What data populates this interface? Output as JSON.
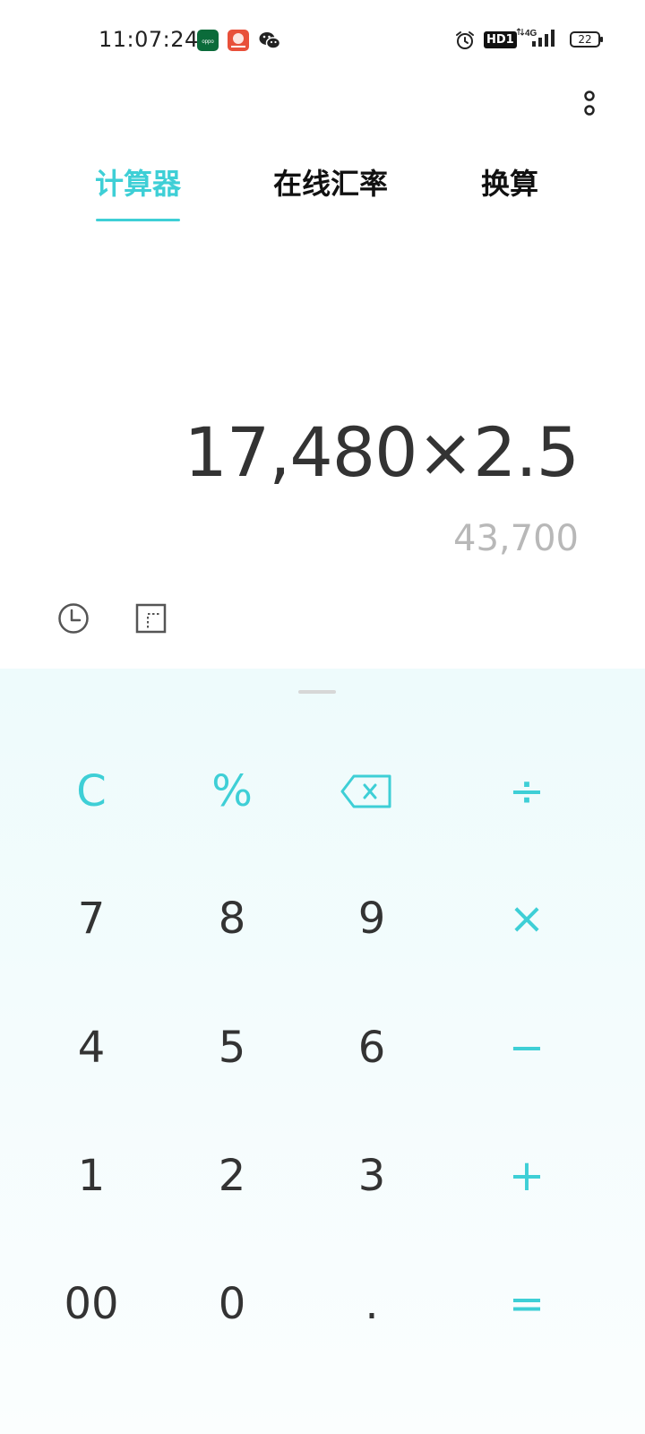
{
  "status_bar": {
    "time": "11:07:24",
    "battery": "22",
    "network": "4G",
    "hd_label": "HD1",
    "app_icons": [
      "oppo-app-icon",
      "red-app-icon",
      "wechat-icon"
    ],
    "indicators": [
      "alarm-icon",
      "hd-icon",
      "signal-icon",
      "battery-icon"
    ]
  },
  "tabs": [
    {
      "label": "计算器",
      "active": true
    },
    {
      "label": "在线汇率",
      "active": false
    },
    {
      "label": "换算",
      "active": false
    }
  ],
  "display": {
    "expression": "17,480×2.5",
    "result": "43,700"
  },
  "tools": [
    "history-icon",
    "scientific-mode-icon"
  ],
  "keypad": {
    "rows": [
      [
        {
          "label": "C",
          "type": "function"
        },
        {
          "label": "%",
          "type": "function"
        },
        {
          "label": "",
          "icon": "backspace-icon",
          "type": "function"
        },
        {
          "label": "÷",
          "type": "operator"
        }
      ],
      [
        {
          "label": "7",
          "type": "digit"
        },
        {
          "label": "8",
          "type": "digit"
        },
        {
          "label": "9",
          "type": "digit"
        },
        {
          "label": "×",
          "type": "operator"
        }
      ],
      [
        {
          "label": "4",
          "type": "digit"
        },
        {
          "label": "5",
          "type": "digit"
        },
        {
          "label": "6",
          "type": "digit"
        },
        {
          "label": "−",
          "type": "operator"
        }
      ],
      [
        {
          "label": "1",
          "type": "digit"
        },
        {
          "label": "2",
          "type": "digit"
        },
        {
          "label": "3",
          "type": "digit"
        },
        {
          "label": "+",
          "type": "operator"
        }
      ],
      [
        {
          "label": "00",
          "type": "digit"
        },
        {
          "label": "0",
          "type": "digit"
        },
        {
          "label": ".",
          "type": "digit"
        },
        {
          "label": "=",
          "type": "operator"
        }
      ]
    ]
  },
  "colors": {
    "accent": "#3ecfd6",
    "text": "#333333",
    "result": "#b8b8b8",
    "keypad_background": "#f1fbfc"
  }
}
